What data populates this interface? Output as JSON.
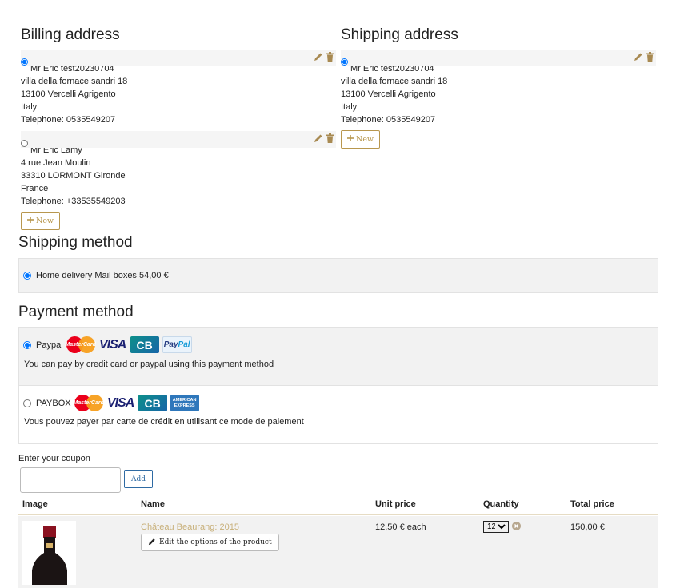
{
  "billing": {
    "title": "Billing address",
    "addresses": [
      {
        "name": "Mr Eric test20230704",
        "street": "villa della fornace sandri 18",
        "city": "13100 Vercelli Agrigento",
        "country": "Italy",
        "phone": "Telephone: 0535549207",
        "selected": true
      },
      {
        "name": "Mr Eric Lamy",
        "street": "4 rue Jean Moulin",
        "city": "33310 LORMONT Gironde",
        "country": "France",
        "phone": "Telephone: +33535549203",
        "selected": false
      }
    ],
    "new_label": "New"
  },
  "shipping": {
    "title": "Shipping address",
    "addresses": [
      {
        "name": "Mr Eric test20230704",
        "street": "villa della fornace sandri 18",
        "city": "13100 Vercelli Agrigento",
        "country": "Italy",
        "phone": "Telephone: 0535549207",
        "selected": true
      }
    ],
    "new_label": "New"
  },
  "shipping_method": {
    "title": "Shipping method",
    "option": "Home delivery Mail boxes 54,00 €"
  },
  "payment_method": {
    "title": "Payment method",
    "options": [
      {
        "label": "Paypal",
        "description": "You can pay by credit card or paypal using this payment method",
        "selected": true
      },
      {
        "label": "PAYBOX",
        "description": "Vous pouvez payer par carte de crédit en utilisant ce mode de paiement",
        "selected": false
      }
    ],
    "card_logos": {
      "mastercard": "MasterCard",
      "visa": "VISA",
      "cb": "CB",
      "paypal_a": "Pay",
      "paypal_b": "Pal",
      "amex": "AMERICAN EXPRESS"
    }
  },
  "coupon": {
    "label": "Enter your coupon",
    "value": "",
    "add_label": "Add"
  },
  "cart": {
    "headers": {
      "image": "Image",
      "name": "Name",
      "unit_price": "Unit price",
      "quantity": "Quantity",
      "total": "Total price"
    },
    "items": [
      {
        "name": "Château Beaurang: 2015",
        "edit_label": "Edit the options of the product",
        "unit_price": "12,50 € each",
        "quantity": "12",
        "total": "150,00 €"
      }
    ]
  },
  "colors": {
    "accent": "#b8974e",
    "link": "#c8b07a",
    "panel": "#f2f2f2"
  },
  "icons": {
    "edit": "pencil-icon",
    "delete": "trash-icon",
    "add": "plus-icon",
    "remove": "remove-circle-icon"
  }
}
